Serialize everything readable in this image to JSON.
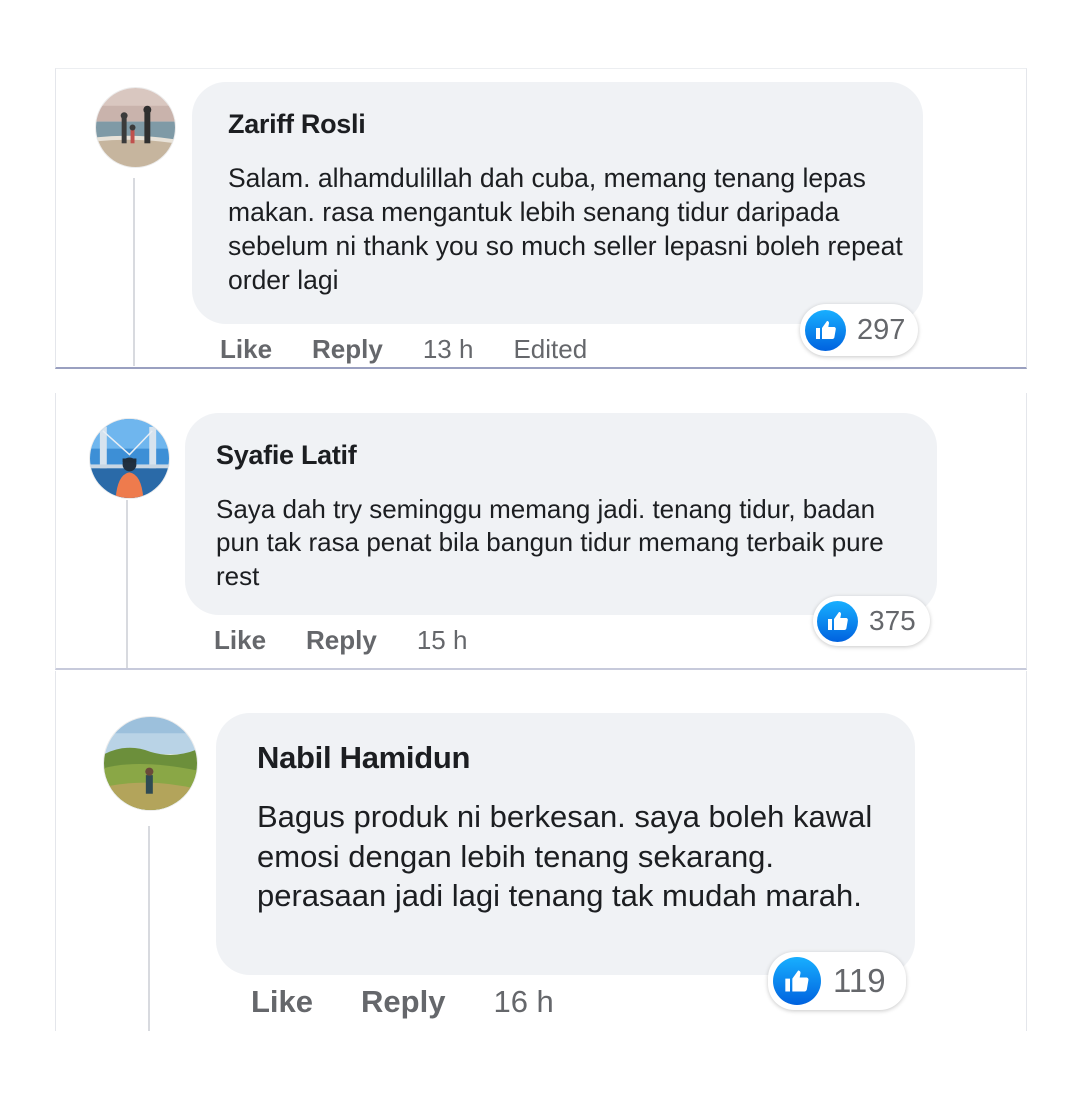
{
  "comments": [
    {
      "author": "Zariff Rosli",
      "text": "Salam. alhamdulillah dah cuba, memang tenang lepas makan. rasa mengantuk lebih senang tidur daripada sebelum ni thank you so much seller lepasni boleh repeat order lagi",
      "like_label": "Like",
      "reply_label": "Reply",
      "time": "13 h",
      "edited": "Edited",
      "reaction_icon": "like-icon",
      "reaction_count": "297"
    },
    {
      "author": "Syafie Latif",
      "text": "Saya dah try seminggu memang jadi. tenang tidur, badan pun tak rasa penat bila bangun tidur memang terbaik pure rest",
      "like_label": "Like",
      "reply_label": "Reply",
      "time": "15 h",
      "reaction_icon": "like-icon",
      "reaction_count": "375"
    },
    {
      "author": "Nabil Hamidun",
      "text": "Bagus produk ni berkesan. saya boleh kawal emosi dengan lebih tenang sekarang. perasaan jadi lagi tenang tak mudah marah.",
      "like_label": "Like",
      "reply_label": "Reply",
      "time": "16 h",
      "reaction_icon": "like-icon",
      "reaction_count": "119"
    }
  ],
  "colors": {
    "bubble_bg": "#f0f2f5",
    "text": "#1c1e21",
    "secondary_text": "#65676b",
    "like_blue": "#1877f2"
  }
}
